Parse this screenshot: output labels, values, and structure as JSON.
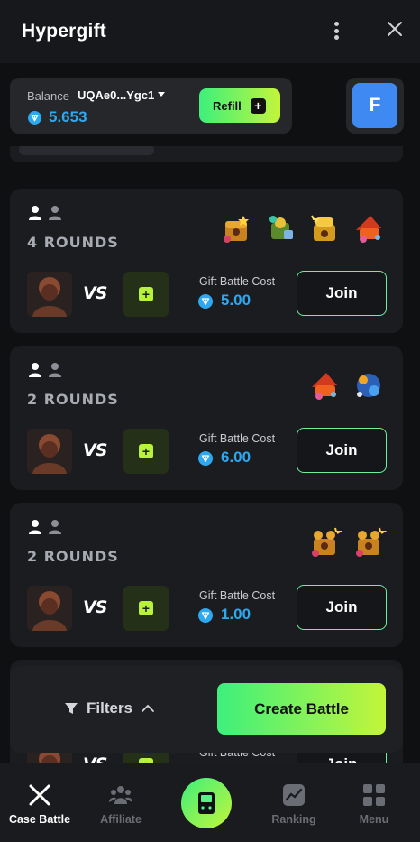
{
  "header": {
    "title": "Hypergift"
  },
  "wallet": {
    "balance_label": "Balance",
    "address": "UQAe0...Ygc1",
    "amount": "5.653",
    "refill_label": "Refill",
    "avatar_letter": "F"
  },
  "battles": [
    {
      "rounds": "4 ROUNDS",
      "cost_label": "Gift Battle Cost",
      "cost": "5.00",
      "join_label": "Join",
      "gifts": [
        "gold-chest",
        "green-box",
        "gold-chest-sparkle",
        "red-cap-gift"
      ]
    },
    {
      "rounds": "2 ROUNDS",
      "cost_label": "Gift Battle Cost",
      "cost": "6.00",
      "join_label": "Join",
      "gifts": [
        "red-cap-gift",
        "blue-dragon-gift"
      ]
    },
    {
      "rounds": "2 ROUNDS",
      "cost_label": "Gift Battle Cost",
      "cost": "1.00",
      "join_label": "Join",
      "gifts": [
        "gold-teddy-chest",
        "gold-teddy-chest"
      ]
    }
  ],
  "battle_common": {
    "vs_label": "VS"
  },
  "peek_card": {
    "cost_label": "Gift Battle Cost",
    "join_label": "Join"
  },
  "dock": {
    "filters_label": "Filters",
    "create_label": "Create Battle"
  },
  "nav": {
    "items": [
      {
        "label": "Case Battle",
        "icon": "swords-icon",
        "active": true
      },
      {
        "label": "Affiliate",
        "icon": "people-icon",
        "active": false
      },
      {
        "label": "",
        "icon": "gameboy-icon",
        "active": false
      },
      {
        "label": "Ranking",
        "icon": "chart-icon",
        "active": false
      },
      {
        "label": "Menu",
        "icon": "grid-icon",
        "active": false
      }
    ]
  },
  "colors": {
    "accent_green": "#3df07c",
    "accent_lime": "#c3f53a",
    "ton_blue": "#2ea8f0",
    "avatar_blue": "#3e8af2"
  }
}
